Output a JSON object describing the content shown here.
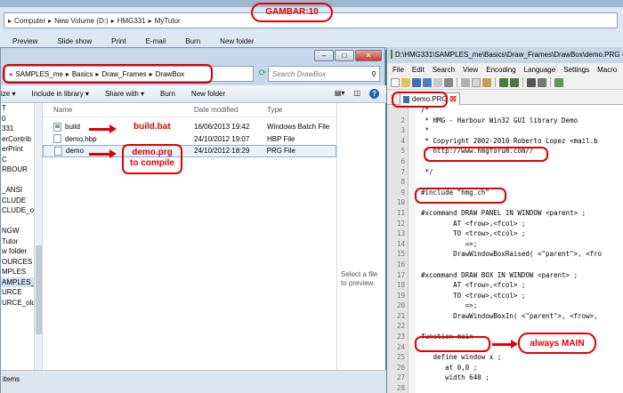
{
  "background_window": {
    "breadcrumb": [
      "Computer",
      "New Volume (D:)",
      "HMG331",
      "MyTutor"
    ],
    "commands": [
      "Preview",
      "Slide show",
      "Print",
      "E-mail",
      "Burn",
      "New folder"
    ]
  },
  "gambar_label": "GAMBAR:10",
  "explorer": {
    "breadcrumb": [
      "SAMPLES_me",
      "Basics",
      "Draw_Frames",
      "DrawBox"
    ],
    "search_placeholder": "Search DrawBox",
    "toolbar": {
      "organize": "ize ▾",
      "include": "Include in library ▾",
      "share": "Share with ▾",
      "burn": "Burn",
      "new_folder": "New folder"
    },
    "nav_items": [
      "T",
      "0",
      "331",
      "erContrib",
      "erPrint",
      "C",
      "RBOUR",
      "",
      "_ANSI",
      "CLUDE",
      "CLUDE_old",
      "",
      "NGW",
      "Tutor",
      "w folder",
      "OURCES",
      "MPLES",
      "AMPLES_me",
      "URCE",
      "URCE_old"
    ],
    "columns": {
      "name": "Name",
      "date": "Date modified",
      "type": "Type"
    },
    "files": [
      {
        "name": "build",
        "date": "16/06/2013 19:42",
        "type": "Windows Batch File",
        "icon": "batch-file-icon"
      },
      {
        "name": "demo.hbp",
        "date": "24/10/2012 19:07",
        "type": "HBP File",
        "icon": "file-icon"
      },
      {
        "name": "demo",
        "date": "24/10/2012 18:29",
        "type": "PRG File",
        "icon": "file-icon"
      }
    ],
    "preview_text": "Select a file to preview.",
    "status": "items"
  },
  "editor": {
    "title": "D:\\HMG331\\SAMPLES_me\\Basics\\Draw_Frames\\DrawBox\\demo.PRG -",
    "menu": [
      "File",
      "Edit",
      "Search",
      "View",
      "Encoding",
      "Language",
      "Settings",
      "Macro"
    ],
    "tab_label": "demo.PRG",
    "line_numbers": [
      "",
      "2",
      "3",
      "4",
      "5",
      "6",
      "7",
      "8",
      "9",
      "10",
      "11",
      "12",
      "13",
      "14",
      "15",
      "16",
      "17",
      "18",
      "19",
      "20",
      "21",
      "22",
      "23",
      "24",
      "25",
      "26",
      "27",
      "28"
    ],
    "lines": [
      "/*",
      " * HMG - Harbour Win32 GUI library Demo",
      " *",
      " * Copyright 2002-2010 Roberto Lopez <mail.b",
      " * http://www.hmgforum.com//",
      " *",
      " */",
      "",
      "#include \"hmg.ch\"",
      "",
      "#xcommand DRAW PANEL IN WINDOW <parent> ;",
      "        AT <frow>,<fcol> ;",
      "        TO <trow>,<tcol> ;",
      "           =>;",
      "        DrawWindowBoxRaised( <\"parent\">, <fro",
      "",
      "#xcommand DRAW BOX IN WINDOW <parent> ;",
      "        AT <frow>,<fcol> ;",
      "        TO <trow>,<tcol> ;",
      "           =>;",
      "        DrawWindowBoxIn( <\"parent\">, <frow>,",
      "",
      "function main",
      "",
      "   define window x ;",
      "      at 0,0 ;",
      "      width 640 ;",
      ""
    ]
  },
  "annotations": {
    "build": "build.bat",
    "demo_line1": "demo.prg",
    "demo_line2": "to compile",
    "main": "always MAIN"
  },
  "colors": {
    "annotation": "#e00000",
    "desktop": "#2f6f88"
  }
}
